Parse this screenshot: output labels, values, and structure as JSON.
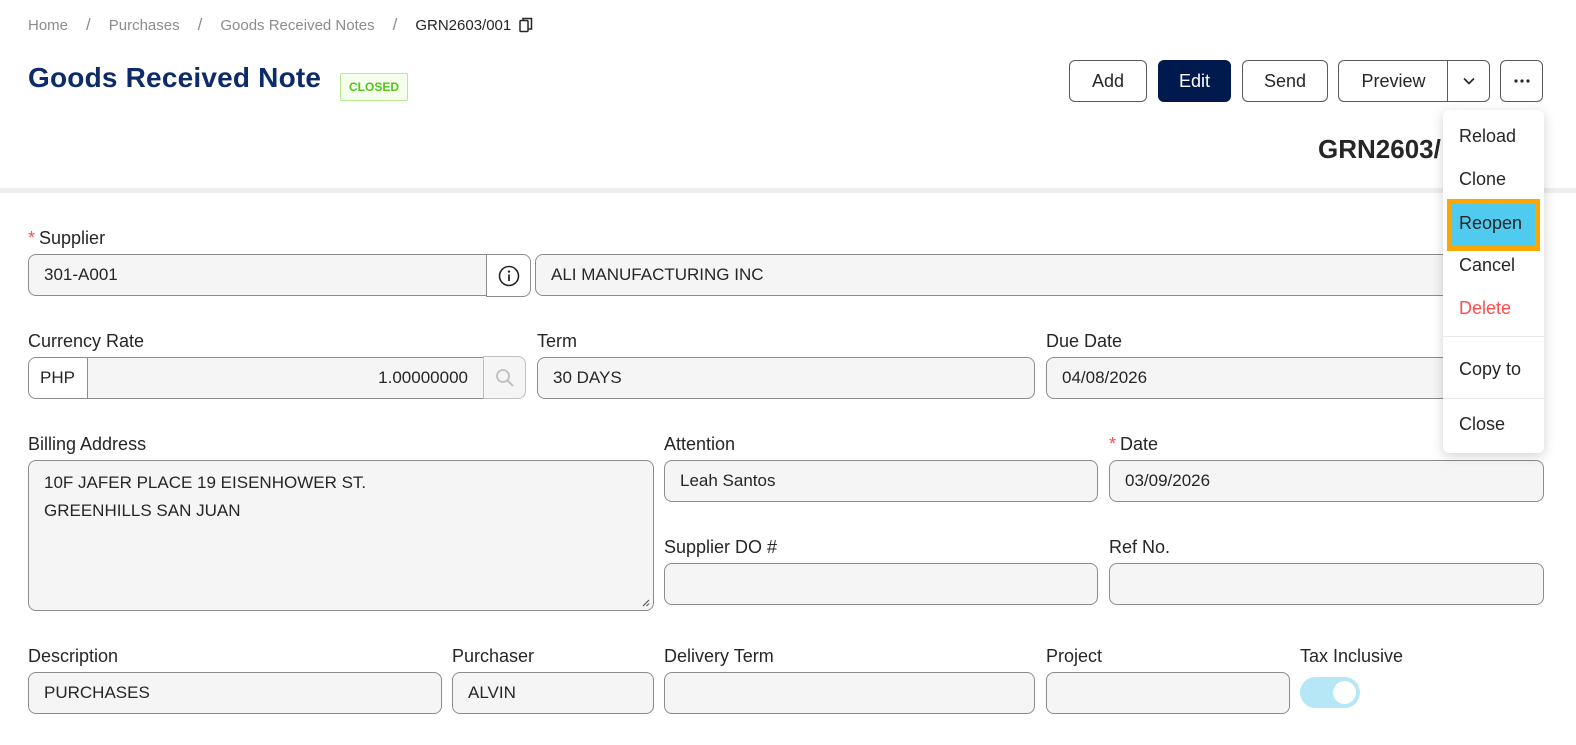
{
  "breadcrumb": {
    "items": [
      "Home",
      "Purchases",
      "Goods Received Notes"
    ],
    "separator": "/",
    "current": "GRN2603/001"
  },
  "header": {
    "title": "Goods Received Note",
    "status": "CLOSED",
    "status_color": "#52c41a",
    "title_color": "#0d2b6b"
  },
  "toolbar": {
    "add": "Add",
    "edit": "Edit",
    "send": "Send",
    "preview": "Preview",
    "more_icon": "ellipsis-icon",
    "caret_icon": "chevron-down-icon",
    "primary_color": "#001a4d"
  },
  "doc_number_visible": "GRN2603/",
  "menu": {
    "items": [
      "Reload",
      "Clone",
      "Reopen",
      "Cancel",
      "Delete",
      "Copy to",
      "Close"
    ],
    "highlighted": "Reopen",
    "highlight_color": "#4ecbef",
    "highlight_border": "#ffa500",
    "danger_color": "#ff4d4f"
  },
  "form": {
    "supplier": {
      "label": "Supplier",
      "required_mark": "*",
      "code": "301-A001",
      "name": "ALI MANUFACTURING INC"
    },
    "currency_rate": {
      "label": "Currency Rate",
      "currency": "PHP",
      "value": "1.00000000"
    },
    "term": {
      "label": "Term",
      "value": "30 DAYS"
    },
    "due_date": {
      "label": "Due Date",
      "value": "04/08/2026"
    },
    "billing_address": {
      "label": "Billing Address",
      "line1": "10F JAFER PLACE 19 EISENHOWER ST.",
      "line2": "GREENHILLS SAN JUAN"
    },
    "attention": {
      "label": "Attention",
      "value": "Leah Santos"
    },
    "date": {
      "label": "Date",
      "required_mark": "*",
      "value": "03/09/2026"
    },
    "supplier_do": {
      "label": "Supplier DO #",
      "value": ""
    },
    "ref_no": {
      "label": "Ref No.",
      "value": ""
    },
    "description": {
      "label": "Description",
      "value": "PURCHASES"
    },
    "purchaser": {
      "label": "Purchaser",
      "value": "ALVIN"
    },
    "delivery_term": {
      "label": "Delivery Term",
      "value": ""
    },
    "project": {
      "label": "Project",
      "value": ""
    },
    "tax_inclusive": {
      "label": "Tax Inclusive",
      "enabled": true
    }
  }
}
